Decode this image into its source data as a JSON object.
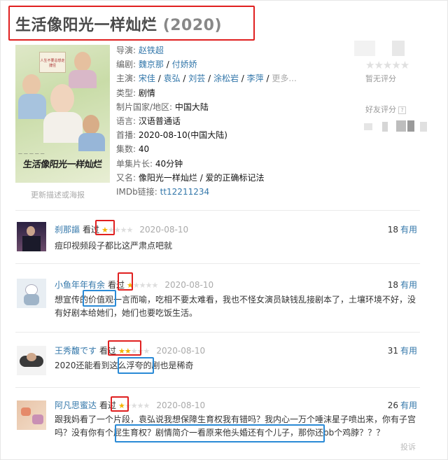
{
  "title": {
    "main": "生活像阳光一样灿烂",
    "year": "(2020)"
  },
  "poster": {
    "edit_link": "更新描述或海报",
    "art_text": "生活像阳光一样灿烂",
    "sign_text": "人生不要总想走捷径"
  },
  "info": {
    "director_label": "导演:",
    "director": "赵铁超",
    "writer_label": "编剧:",
    "writers": [
      "魏京那",
      "付娇娇"
    ],
    "cast_label": "主演:",
    "cast": [
      "宋佳",
      "袁弘",
      "刘芸",
      "涂松岩",
      "李萍"
    ],
    "cast_more": "更多...",
    "genre_label": "类型:",
    "genre": "剧情",
    "country_label": "制片国家/地区:",
    "country": "中国大陆",
    "language_label": "语言:",
    "language": "汉语普通话",
    "premiere_label": "首播:",
    "premiere": "2020-08-10(中国大陆)",
    "episodes_label": "集数:",
    "episodes": "40",
    "runtime_label": "单集片长:",
    "runtime": "40分钟",
    "aka_label": "又名:",
    "aka": "像阳光一样灿烂 / 爱的正确标记法",
    "imdb_label": "IMDb链接:",
    "imdb": "tt12211234"
  },
  "rating": {
    "stars": "★★★★★",
    "none_text": "暂无评分",
    "friend_label": "好友评分",
    "help": "?"
  },
  "comments": [
    {
      "user": "刹那謳",
      "seen": "看过",
      "stars_on": "★",
      "stars_off": "★★★★",
      "date": "2020-08-10",
      "useful_count": "18",
      "useful_label": "有用",
      "text": "痘印视频段子都比这严肃点吧就"
    },
    {
      "user": "小鱼年年有余",
      "seen": "看过",
      "stars_on": "★",
      "stars_off": "★★★★",
      "date": "2020-08-10",
      "useful_count": "18",
      "useful_label": "有用",
      "text": "想宣传的价值观一言而喻，吃相不要太难看，我也不怪女演员缺钱乱接剧本了，土壤环境不好，没有好剧本给她们，她们也要吃饭生活。"
    },
    {
      "user": "王秀馥です",
      "seen": "看过",
      "stars_on": "★★",
      "stars_off": "★★★",
      "date": "2020-08-10",
      "useful_count": "31",
      "useful_label": "有用",
      "text": "2020还能看到这么浮夸的剧也是稀奇"
    },
    {
      "user": "阿凡思蜜达",
      "seen": "看过",
      "stars_on": "★",
      "stars_off": "★★★★",
      "date": "2020-08-10",
      "useful_count": "26",
      "useful_label": "有用",
      "text": "跟我妈看了一个片段，袁弘说我想保障生育权我有错吗？我内心一万个唾沫星子喷出来，你有子宫吗？没有你有个屁生育权？剧情简介一看原来他头婚还有个儿子，那你还bb个鸡脖？？？"
    }
  ],
  "report": "投诉",
  "colors": {
    "link": "#3377aa",
    "star": "#f4b400",
    "red_box": "#e02020",
    "blue_box": "#2a8ad6"
  }
}
